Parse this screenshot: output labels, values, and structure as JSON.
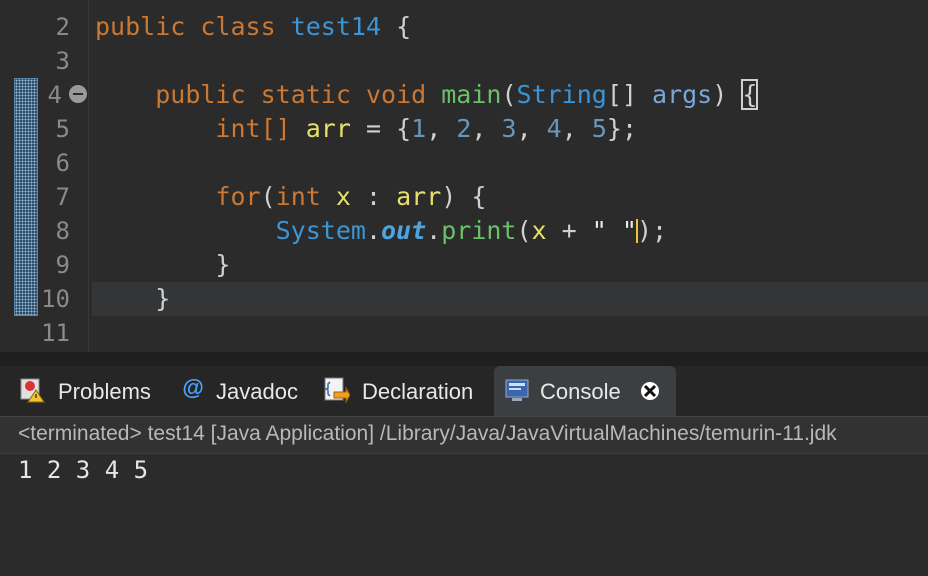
{
  "editor": {
    "line_numbers": [
      "2",
      "3",
      "4",
      "5",
      "6",
      "7",
      "8",
      "9",
      "10",
      "11"
    ],
    "code": {
      "line2": {
        "kw1": "public",
        "kw2": "class",
        "name": "test14",
        "brace": "{"
      },
      "line4": {
        "kw1": "public",
        "kw2": "static",
        "kw3": "void",
        "method": "main",
        "open": "(",
        "type": "String",
        "arr": "[]",
        "param": "args",
        "close": ")",
        "brace": "{"
      },
      "line5": {
        "type": "int[]",
        "var": "arr",
        "eq": "=",
        "open": "{",
        "n1": "1",
        "n2": "2",
        "n3": "3",
        "n4": "4",
        "n5": "5",
        "close": "};"
      },
      "line7": {
        "kw": "for",
        "open": "(",
        "type": "int",
        "var": "x",
        "colon": ":",
        "arr": "arr",
        "close": ")",
        "brace": "{"
      },
      "line8": {
        "cls": "System",
        "dot1": ".",
        "field": "out",
        "dot2": ".",
        "method": "print",
        "open": "(",
        "var": "x",
        "plus": "+",
        "str_open": "\" \"",
        "close": ");"
      },
      "line9": {
        "brace": "}"
      },
      "line10": {
        "brace": "}"
      }
    }
  },
  "tabs": [
    {
      "label": "Problems",
      "icon": "problems-icon"
    },
    {
      "label": "Javadoc",
      "icon": "javadoc-icon"
    },
    {
      "label": "Declaration",
      "icon": "declaration-icon"
    },
    {
      "label": "Console",
      "icon": "console-icon"
    }
  ],
  "console": {
    "header": "<terminated> test14 [Java Application] /Library/Java/JavaVirtualMachines/temurin-11.jdk",
    "output": "1 2 3 4 5"
  }
}
